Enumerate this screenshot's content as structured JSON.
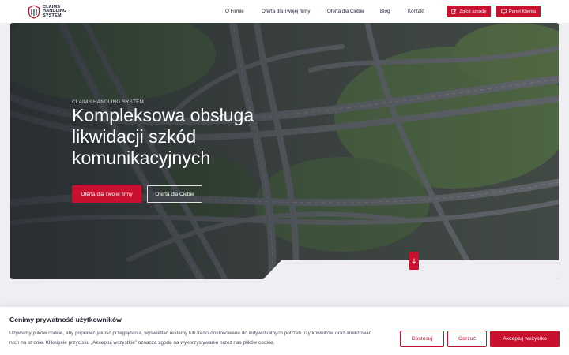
{
  "header": {
    "logo": {
      "line1": "CLAIMS",
      "line2": "HANDLING",
      "line3": "SYSTEM."
    },
    "nav": [
      {
        "label": "O Firmie"
      },
      {
        "label": "Oferta dla Twojej firmy"
      },
      {
        "label": "Oferta dla Ciebie"
      },
      {
        "label": "Blog"
      },
      {
        "label": "Kontakt"
      }
    ],
    "report_damage_label": "Zgłoś szkodę",
    "client_panel_label": "Panel Klienta"
  },
  "hero": {
    "eyebrow": "CLAIMS HANDLING SYSTEM",
    "headline": [
      "Kompleksowa obsługa",
      "likwidacji szkód",
      "komunikacyjnych"
    ],
    "primary_cta": "Oferta dla Twojej firmy",
    "secondary_cta": "Oferta dla Ciebie"
  },
  "cookie": {
    "title": "Cenimy prywatność użytkowników",
    "text": "Używamy plików cookie, aby poprawić jakość przeglądania, wyświetlać reklamy lub treści dostosowane do indywidualnych potrzeb użytkowników oraz analizować ruch na stronie. Kliknięcie przycisku „Akceptuj wszystkie” oznacza zgodę na wykorzystywanie przez nas plików cookie.",
    "customize_label": "Dostosuj",
    "reject_label": "Odrzuć",
    "accept_label": "Akceptuj wszystko"
  },
  "colors": {
    "brand_red": "#c9112f",
    "page_bg": "#eeeef3"
  },
  "icons": {
    "report": "edit-icon",
    "panel": "monitor-icon",
    "scroll": "arrow-down-icon"
  }
}
